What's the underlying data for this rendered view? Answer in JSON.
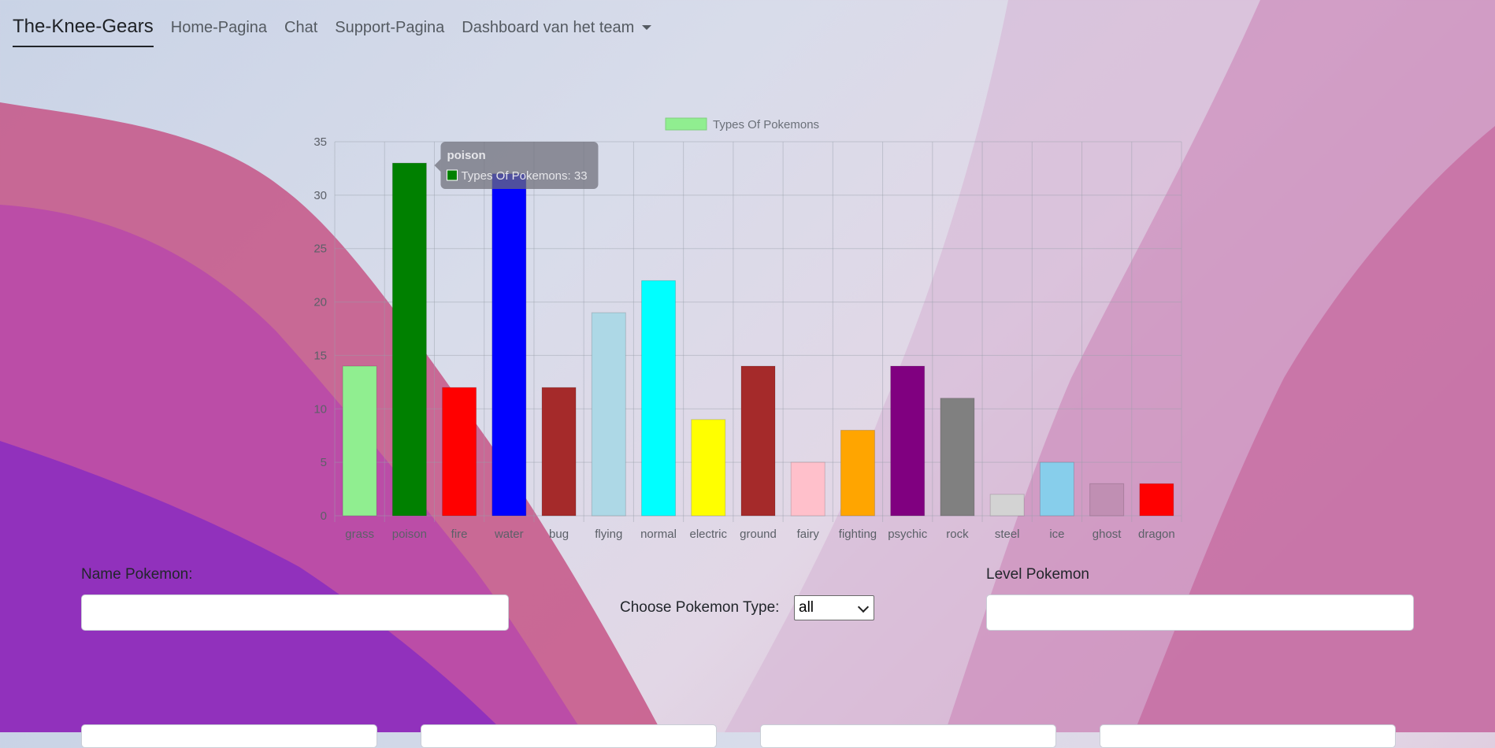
{
  "nav": {
    "brand": "The-Knee-Gears",
    "links": [
      "Home-Pagina",
      "Chat",
      "Support-Pagina",
      "Dashboard van het team"
    ]
  },
  "chart_data": {
    "type": "bar",
    "legend": "Types Of Pokemons",
    "categories": [
      "grass",
      "poison",
      "fire",
      "water",
      "bug",
      "flying",
      "normal",
      "electric",
      "ground",
      "fairy",
      "fighting",
      "psychic",
      "rock",
      "steel",
      "ice",
      "ghost",
      "dragon"
    ],
    "values": [
      14,
      33,
      12,
      32,
      12,
      19,
      22,
      9,
      14,
      5,
      8,
      14,
      11,
      2,
      5,
      3,
      3
    ],
    "colors": [
      "#90ee90",
      "#008000",
      "#ff0000",
      "#0000ff",
      "#a52a2a",
      "#add8e6",
      "#00ffff",
      "#ffff00",
      "#a52a2a",
      "#ffc0cb",
      "#ffa500",
      "#800080",
      "#808080",
      "#d3d3d3",
      "#87ceeb",
      "#c08fb3",
      "#ff0000"
    ],
    "ylim": [
      0,
      35
    ],
    "yticks": [
      0,
      5,
      10,
      15,
      20,
      25,
      30,
      35
    ],
    "grid": true,
    "legend_position": "top",
    "tooltip": {
      "title": "poison",
      "label": "Types Of Pokemons: 33"
    }
  },
  "form": {
    "name_label": "Name Pokemon:",
    "type_label": "Choose Pokemon Type:",
    "type_selected": "all",
    "level_label": "Level Pokemon"
  }
}
